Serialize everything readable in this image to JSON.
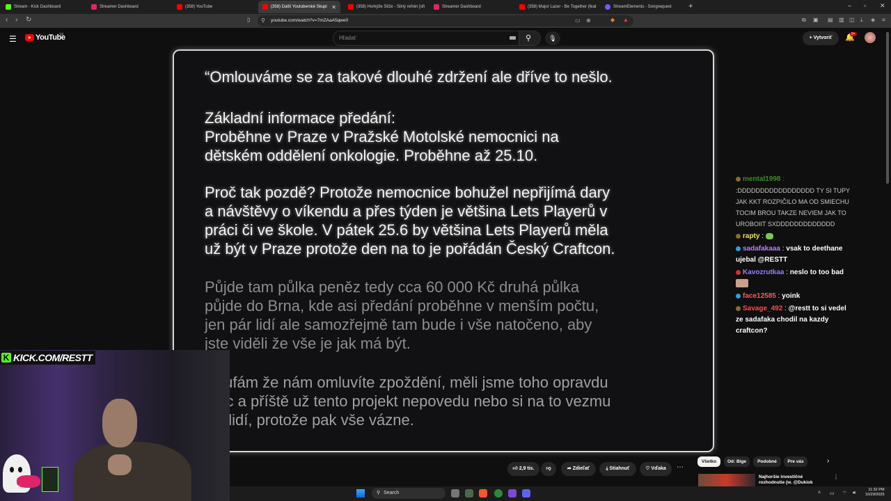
{
  "browser": {
    "tabs": [
      {
        "title": "Stream - Kick Dashboard",
        "color": "#53fc18"
      },
      {
        "title": "Streamer Dashboard",
        "color": "#e0246a"
      },
      {
        "title": "(358) YouTube",
        "color": "#ff0000"
      },
      {
        "title": "(358) Další Youtuberské Skupi",
        "color": "#ff0000"
      },
      {
        "title": "(358) Horkýže Slíže - Silný refrén [ofi",
        "color": "#ff0000"
      },
      {
        "title": "Streamer Dashboard",
        "color": "#e0246a"
      },
      {
        "title": "(358) Major Lazer - Be Together (feat",
        "color": "#ff0000"
      },
      {
        "title": "StreamElements - Songrequest",
        "color": "#6f5cff"
      }
    ],
    "url": "youtube.com/watch?v=7mZAaA5qwe0"
  },
  "youtube": {
    "logo_text": "YouTube",
    "country": "SK",
    "search_placeholder": "Hľadať",
    "create_label": "Vytvoriť",
    "notif_count": "9+"
  },
  "slide": {
    "lines": [
      {
        "text": "“Omlouváme se za takové dlouhé zdržení ale dříve to nešlo.",
        "style": "bright"
      },
      {
        "text": "Základní informace předání:",
        "style": "bright"
      },
      {
        "text": "Proběhne v Praze v Pražské Motolské nemocnici na",
        "style": "bright"
      },
      {
        "text": "dětském oddělení onkologie. Proběhne až 25.10.",
        "style": "bright"
      },
      {
        "text": "Proč tak pozdě? Protože nemocnice bohužel nepřijímá dary",
        "style": "bright"
      },
      {
        "text": "a návštěvy o víkendu a přes týden je většina Lets Playerů v",
        "style": "bright"
      },
      {
        "text": "práci či ve škole. V pátek 25.6 by většina Lets Playerů měla",
        "style": "bright"
      },
      {
        "text": "už být v Praze protože den na to je pořádán Český Craftcon.",
        "style": "bright"
      },
      {
        "text": "Půjde tam půlka peněz tedy cca 60 000 Kč druhá půlka",
        "style": "dim"
      },
      {
        "text": "půjde do Brna, kde asi předání proběhne v menším počtu,",
        "style": "dim"
      },
      {
        "text": "jen pár lidí ale samozřejmě tam bude i vše natočeno, aby",
        "style": "dim"
      },
      {
        "text": "jste viděli že vše je jak má být.",
        "style": "dim"
      },
      {
        "text": "Doufám že nám omluvíte zpoždění, měli jsme toho opravdu",
        "style": "dim2"
      },
      {
        "text": "moc a příště už tento projekt nepovedu nebo si na to vezmu",
        "style": "dim2"
      },
      {
        "text": "víc lidí, protože pak vše vázne.",
        "style": "dim2"
      }
    ]
  },
  "chat": {
    "messages": [
      {
        "user": "mental1998",
        "sep": " :",
        "text": " :DDDDDDDDDDDDDDDDD TY SI TUPY JAK KKT ROZPIČILO MA OD SMIECHU TOCIM BROU TAKZE NEVIEM JAK TO UROBOIIT SXDDDDDDDDDDDDD",
        "color": "#3d8a2a",
        "text_color": "#c8c8c8",
        "icon": "#8a6d2a"
      },
      {
        "user": "rapty",
        "sep": " :",
        "text": " ",
        "color": "#f0e25a",
        "text_color": "#ffffff",
        "icon": "#8a6d2a",
        "emote": true
      },
      {
        "user": "sadafakaaa",
        "sep": " :",
        "text": " vsak to deethane ujebal @RESTT",
        "color": "#c07cff",
        "text_color": "#ffffff",
        "icon": "#2aa0e0"
      },
      {
        "user": "Kavozrutkaa",
        "sep": " :",
        "text": " neslo to too bad",
        "color": "#9a7cff",
        "text_color": "#ffffff",
        "icon": "#d03030",
        "emote2": true
      },
      {
        "user": "face12585",
        "sep": " :",
        "text": " yoink",
        "color": "#ff5a5a",
        "text_color": "#ffffff",
        "icon": "#2aa0e0"
      },
      {
        "user": "Savage_492",
        "sep": " :",
        "text": " @restt to si vedel ze sadafaka chodil na kazdy craftcon?",
        "color": "#ff4a4a",
        "text_color": "#ffffff",
        "icon": "#8a6d2a"
      }
    ]
  },
  "overlay": {
    "kick_letter": "K",
    "kick_text": "KICK.COM/RESTT"
  },
  "actions": {
    "like_count": "2,9 tis.",
    "share": "Zdieľať",
    "download": "Stiahnuť",
    "thanks": "Vďaka"
  },
  "chips": [
    "Všetko",
    "Od: Bige",
    "Podobné",
    "Pre vás"
  ],
  "recommended": {
    "title": "Najhoršie investičné rozhodnutie (w. @Dukiok"
  },
  "taskbar": {
    "search": "Search",
    "time": "11:32 PM",
    "date": "10/29/2025"
  }
}
